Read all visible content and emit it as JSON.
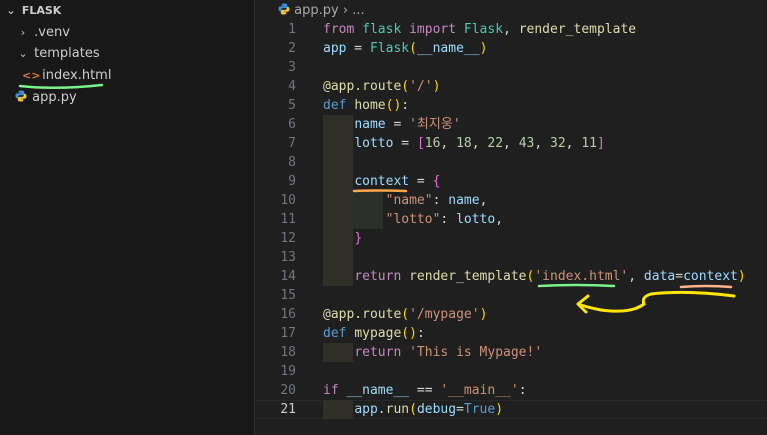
{
  "explorer": {
    "folder": "FLASK",
    "items": [
      {
        "label": ".venv",
        "kind": "folder"
      },
      {
        "label": "templates",
        "kind": "folder"
      },
      {
        "label": "index.html",
        "kind": "html-file"
      },
      {
        "label": "app.py",
        "kind": "python-file"
      }
    ]
  },
  "breadcrumb": {
    "file": "app.py",
    "separator": "›",
    "more": "..."
  },
  "editor": {
    "active_line": 21,
    "lines": [
      {
        "n": "1",
        "tokens": [
          [
            "kw2",
            "from"
          ],
          [
            "op",
            " "
          ],
          [
            "cls",
            "flask"
          ],
          [
            "op",
            " "
          ],
          [
            "kw2",
            "import"
          ],
          [
            "op",
            " "
          ],
          [
            "cls",
            "Flask"
          ],
          [
            "op",
            ", "
          ],
          [
            "fn",
            "render_template"
          ]
        ]
      },
      {
        "n": "2",
        "tokens": [
          [
            "var",
            "app"
          ],
          [
            "op",
            " = "
          ],
          [
            "cls",
            "Flask"
          ],
          [
            "brk1",
            "("
          ],
          [
            "var",
            "__name__"
          ],
          [
            "brk1",
            ")"
          ]
        ]
      },
      {
        "n": "3",
        "tokens": []
      },
      {
        "n": "4",
        "tokens": [
          [
            "dec",
            "@app.route"
          ],
          [
            "brk1",
            "("
          ],
          [
            "str",
            "'/'"
          ],
          [
            "brk1",
            ")"
          ]
        ]
      },
      {
        "n": "5",
        "tokens": [
          [
            "kw",
            "def"
          ],
          [
            "op",
            " "
          ],
          [
            "fn",
            "home"
          ],
          [
            "brk1",
            "()"
          ],
          [
            "op",
            ":"
          ]
        ]
      },
      {
        "n": "6",
        "indent": 1,
        "tokens": [
          [
            "var",
            "name"
          ],
          [
            "op",
            " = "
          ],
          [
            "str",
            "'최지웅'"
          ]
        ]
      },
      {
        "n": "7",
        "indent": 1,
        "tokens": [
          [
            "var",
            "lotto"
          ],
          [
            "op",
            " = "
          ],
          [
            "brk2",
            "["
          ],
          [
            "num",
            "16"
          ],
          [
            "op",
            ", "
          ],
          [
            "num",
            "18"
          ],
          [
            "op",
            ", "
          ],
          [
            "num",
            "22"
          ],
          [
            "op",
            ", "
          ],
          [
            "num",
            "43"
          ],
          [
            "op",
            ", "
          ],
          [
            "num",
            "32"
          ],
          [
            "op",
            ", "
          ],
          [
            "num",
            "11"
          ],
          [
            "brk2",
            "]"
          ]
        ]
      },
      {
        "n": "8",
        "indent": 1,
        "tokens": []
      },
      {
        "n": "9",
        "indent": 1,
        "tokens": [
          [
            "var",
            "context"
          ],
          [
            "op",
            " = "
          ],
          [
            "brk2",
            "{"
          ]
        ]
      },
      {
        "n": "10",
        "indent": 2,
        "tokens": [
          [
            "op",
            "    "
          ],
          [
            "str",
            "\"name\""
          ],
          [
            "op",
            ": "
          ],
          [
            "var",
            "name"
          ],
          [
            "op",
            ","
          ]
        ]
      },
      {
        "n": "11",
        "indent": 2,
        "tokens": [
          [
            "op",
            "    "
          ],
          [
            "str",
            "\"lotto\""
          ],
          [
            "op",
            ": "
          ],
          [
            "var",
            "lotto"
          ],
          [
            "op",
            ","
          ]
        ]
      },
      {
        "n": "12",
        "indent": 1,
        "tokens": [
          [
            "brk2",
            "}"
          ]
        ]
      },
      {
        "n": "13",
        "indent": 1,
        "tokens": []
      },
      {
        "n": "14",
        "indent": 1,
        "tokens": [
          [
            "kw2",
            "return"
          ],
          [
            "op",
            " "
          ],
          [
            "fn",
            "render_template"
          ],
          [
            "brk1",
            "("
          ],
          [
            "str",
            "'index.html'"
          ],
          [
            "op",
            ", "
          ],
          [
            "var",
            "data"
          ],
          [
            "op",
            "="
          ],
          [
            "var",
            "context"
          ],
          [
            "brk1",
            ")"
          ]
        ]
      },
      {
        "n": "15",
        "tokens": []
      },
      {
        "n": "16",
        "tokens": [
          [
            "dec",
            "@app.route"
          ],
          [
            "brk1",
            "("
          ],
          [
            "str",
            "'/mypage'"
          ],
          [
            "brk1",
            ")"
          ]
        ]
      },
      {
        "n": "17",
        "tokens": [
          [
            "kw",
            "def"
          ],
          [
            "op",
            " "
          ],
          [
            "fn",
            "mypage"
          ],
          [
            "brk1",
            "()"
          ],
          [
            "op",
            ":"
          ]
        ]
      },
      {
        "n": "18",
        "indent": 1,
        "tokens": [
          [
            "kw2",
            "return"
          ],
          [
            "op",
            " "
          ],
          [
            "str",
            "'This is Mypage!'"
          ]
        ]
      },
      {
        "n": "19",
        "tokens": []
      },
      {
        "n": "20",
        "tokens": [
          [
            "kw2",
            "if"
          ],
          [
            "op",
            " "
          ],
          [
            "var",
            "__name__"
          ],
          [
            "op",
            " == "
          ],
          [
            "str",
            "'__main__'"
          ],
          [
            "op",
            ":"
          ]
        ]
      },
      {
        "n": "21",
        "indent": 1,
        "tokens": [
          [
            "var",
            "app"
          ],
          [
            "op",
            "."
          ],
          [
            "fn",
            "run"
          ],
          [
            "brk1",
            "("
          ],
          [
            "var",
            "debug"
          ],
          [
            "op",
            "="
          ],
          [
            "kw",
            "True"
          ],
          [
            "brk1",
            ")"
          ]
        ]
      }
    ]
  },
  "colors": {
    "annotation_green": "#7cf08a",
    "annotation_orange": "#ffa64d",
    "annotation_salmon": "#ffb38a",
    "annotation_yellow": "#ffe600"
  }
}
